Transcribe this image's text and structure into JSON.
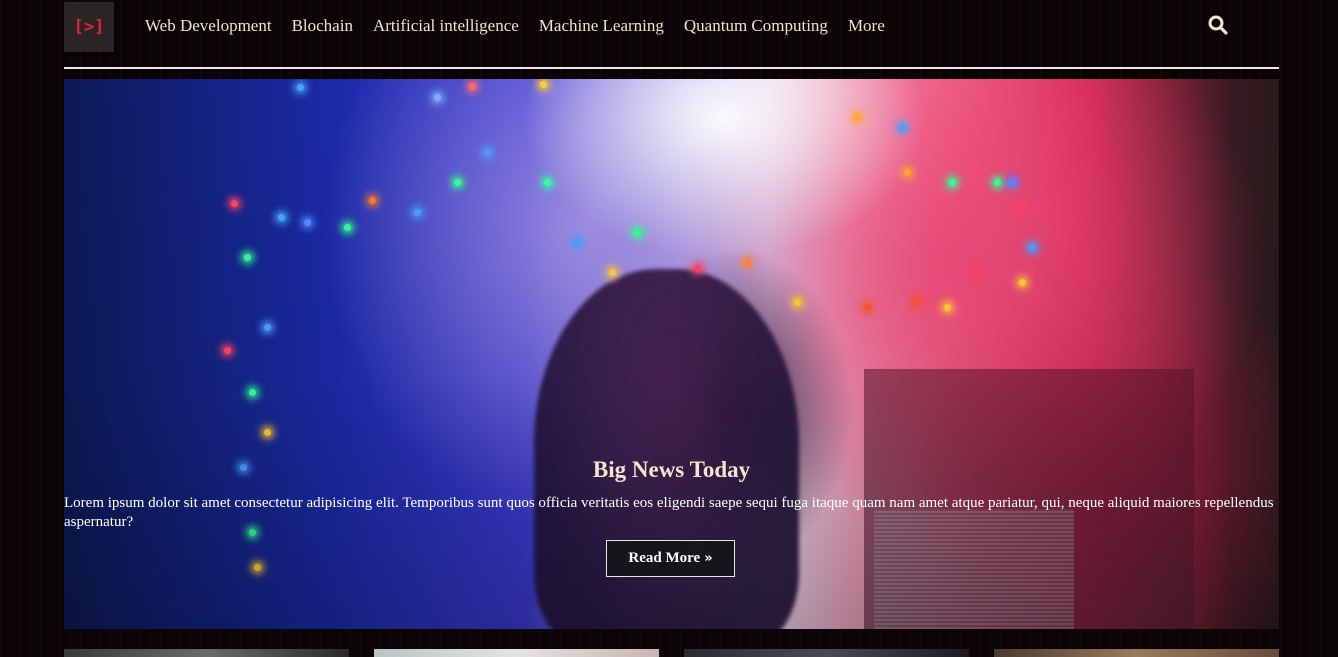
{
  "logo": {
    "text": "[>]"
  },
  "nav": {
    "items": [
      {
        "label": "Web Development",
        "id": "web-development"
      },
      {
        "label": "Blochain",
        "id": "blochain"
      },
      {
        "label": "Artificial intelligence",
        "id": "artificial-intelligence"
      },
      {
        "label": "Machine Learning",
        "id": "machine-learning"
      },
      {
        "label": "Quantum Computing",
        "id": "quantum-computing"
      },
      {
        "label": "More",
        "id": "more"
      }
    ]
  },
  "search": {
    "icon": "search-icon"
  },
  "hero": {
    "title": "Big News Today",
    "text": "Lorem ipsum dolor sit amet consectetur adipisicing elit. Temporibus sunt quos officia veritatis eos eligendi saepe sequi fuga itaque quam nam amet atque pariatur, qui, neque aliquid maiores repellendus aspernatur?",
    "button_label": "Read More",
    "button_icon": "double-chevron-right-icon",
    "button_icon_glyph": "»"
  },
  "colors": {
    "accent": "#e0243a",
    "nav_text": "#f3e3cc",
    "background": "#0a0406"
  }
}
